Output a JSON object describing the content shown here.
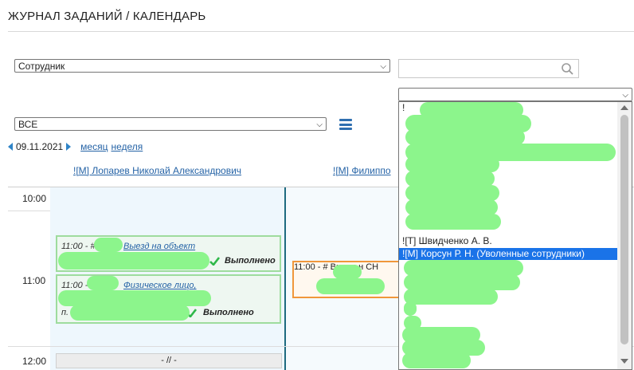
{
  "header": {
    "title": "ЖУРНАЛ ЗАДАНИЙ / КАЛЕНДАРЬ"
  },
  "filters": {
    "employee_select": "Сотрудник",
    "status_select": "ВСЕ",
    "search_placeholder": ""
  },
  "nav": {
    "date": "09.11.2021",
    "view_month": "месяц",
    "view_week": "неделя"
  },
  "columns": [
    {
      "name": "![М] Лопарев Николай Александрович"
    },
    {
      "name": "![М] Филиппо"
    }
  ],
  "times": [
    "10:00",
    "11:00",
    "12:00"
  ],
  "events": [
    {
      "time": "11:00 - #",
      "title": "Выезд на объект",
      "status": "Выполнено"
    },
    {
      "time": "11:00 - #",
      "title": "Физическое лицо,",
      "prefix": "п.",
      "status": "Выполнено"
    },
    {
      "time": "11:00 - #",
      "title": "Выезд н",
      "suffix": "СН"
    }
  ],
  "empty_slot": "- // -",
  "dropdown": {
    "top_char": "!",
    "options": [
      {
        "label": "![Т] Швидченко А. В.",
        "selected": false
      },
      {
        "label": "![М] Корсун Р. Н. (Уволенные сотрудники)",
        "selected": true
      }
    ]
  },
  "colors": {
    "accent": "#2563a6",
    "done_border": "#9edc9e",
    "active_border": "#f0973a",
    "selected": "#1a73e8"
  }
}
